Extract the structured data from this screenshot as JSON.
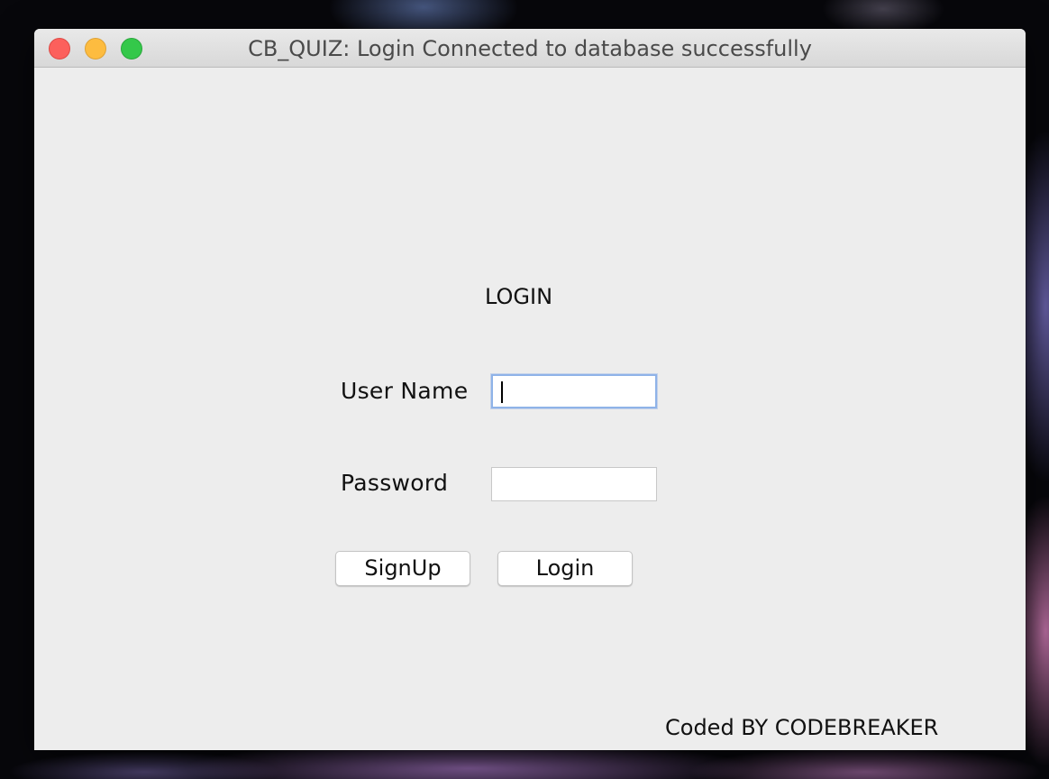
{
  "window": {
    "title": "CB_QUIZ: Login Connected to database successfully"
  },
  "form": {
    "heading": "LOGIN",
    "username_label": "User Name",
    "username_value": "",
    "password_label": "Password",
    "password_value": "",
    "signup_label": "SignUp",
    "login_label": "Login"
  },
  "footer": {
    "credit": "Coded BY CODEBREAKER"
  },
  "colors": {
    "close": "#fc605c",
    "minimize": "#fdbc40",
    "zoom": "#34c84a",
    "focus_ring": "#8fb3e8",
    "window_bg": "#ededed"
  },
  "icons": {
    "close": "close-icon",
    "minimize": "minimize-icon",
    "zoom": "zoom-icon"
  }
}
